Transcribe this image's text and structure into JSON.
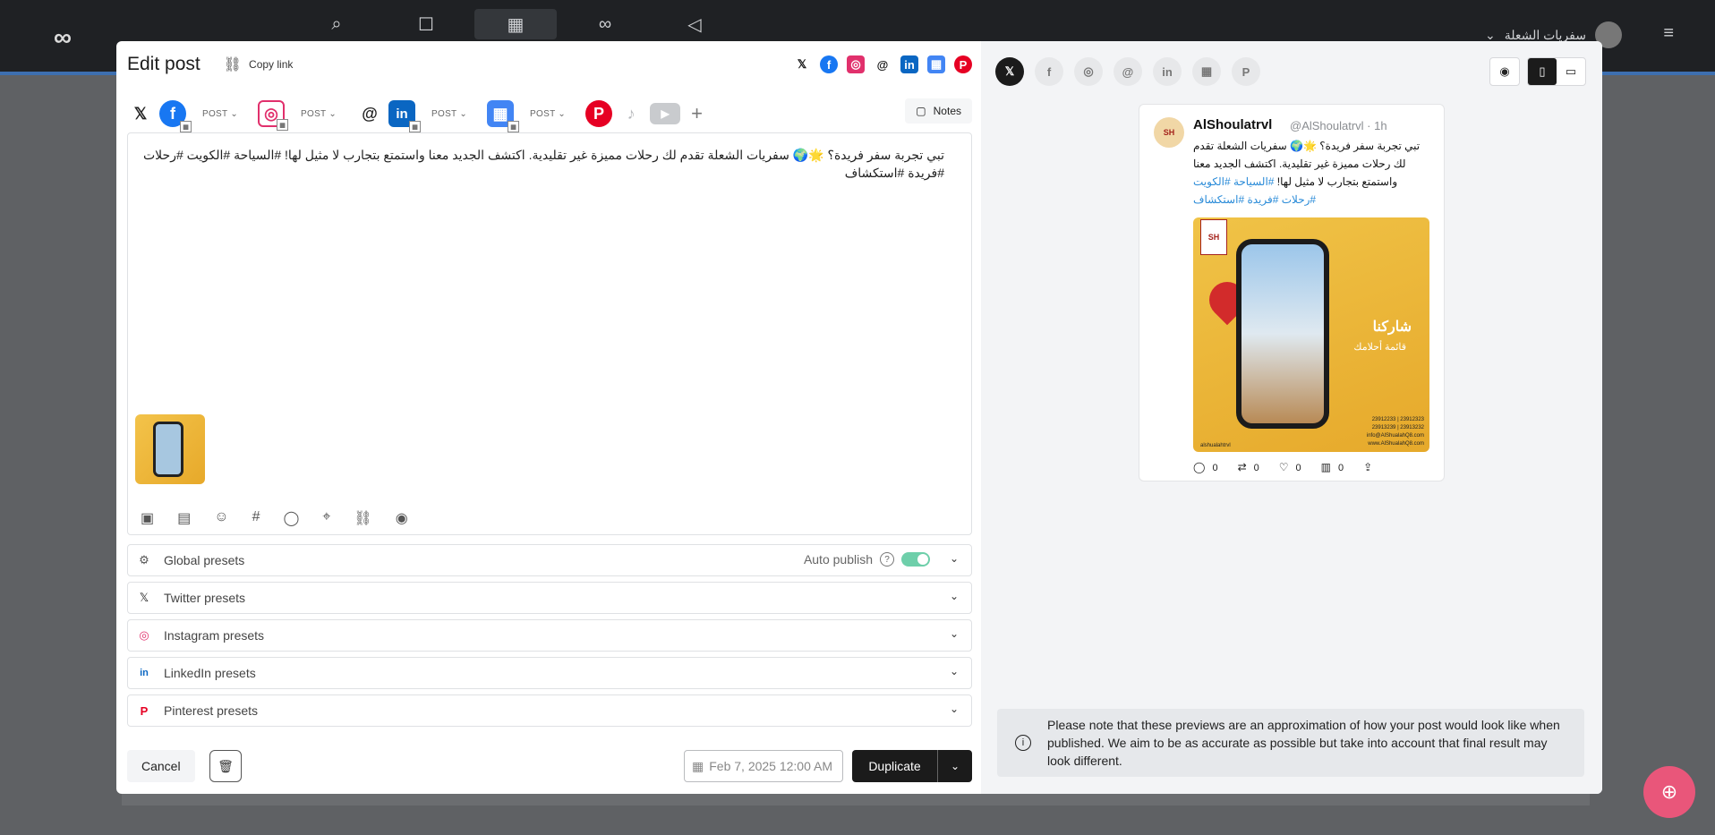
{
  "topbar": {
    "logo": "∞",
    "nav_icons": [
      "analytics-icon",
      "chat-icon",
      "calendar-icon",
      "link-icon",
      "megaphone-icon"
    ],
    "account_name": "سفريات الشعلة",
    "menu_icon": "≡"
  },
  "editor": {
    "title": "Edit post",
    "copy_link": "Copy link",
    "networks": [
      "X",
      "Facebook",
      "Instagram",
      "Threads",
      "LinkedIn",
      "Google Business",
      "Pinterest"
    ],
    "accounts": [
      {
        "network": "X",
        "glyph": "𝕏",
        "color": "#222222"
      },
      {
        "network": "Facebook",
        "glyph": "f",
        "color": "#1877f2",
        "type": "POST"
      },
      {
        "network": "Instagram",
        "glyph": "◎",
        "color": "#e1306c",
        "type": "POST"
      },
      {
        "network": "Threads",
        "glyph": "@",
        "color": "#222222"
      },
      {
        "network": "LinkedIn",
        "glyph": "in",
        "color": "#0a66c2",
        "type": "POST"
      },
      {
        "network": "Google Business",
        "glyph": "▦",
        "color": "#4285f4",
        "type": "POST"
      },
      {
        "network": "Pinterest",
        "glyph": "P",
        "color": "#e60023"
      },
      {
        "network": "TikTok",
        "glyph": "♪",
        "color": "#b7b9bc"
      },
      {
        "network": "YouTube",
        "glyph": "▶",
        "color": "#b7b9bc"
      }
    ],
    "add_label": "+",
    "notes_label": "Notes",
    "post_text": "تبي تجربة سفر فريدة؟ 🌟🌍 سفريات الشعلة تقدم لك رحلات مميزة غير تقليدية. اكتشف الجديد معنا واستمتع بتجارب لا مثيل لها! #السياحة #الكويت #رحلات #فريدة #استكشاف",
    "toolbar_icons": [
      "image-icon",
      "document-icon",
      "emoji-icon",
      "hashtag-icon",
      "comment-icon",
      "location-icon",
      "link-icon",
      "ai-icon"
    ],
    "presets": [
      {
        "label": "Global presets",
        "icon": "⚙",
        "color": "#555555"
      },
      {
        "label": "Twitter presets",
        "icon": "𝕏",
        "color": "#222222"
      },
      {
        "label": "Instagram presets",
        "icon": "◎",
        "color": "#e1306c"
      },
      {
        "label": "LinkedIn presets",
        "icon": "in",
        "color": "#0a66c2"
      },
      {
        "label": "Pinterest presets",
        "icon": "P",
        "color": "#e60023"
      }
    ],
    "auto_publish": "Auto publish",
    "auto_publish_on": true,
    "cancel": "Cancel",
    "date": "Feb 7, 2025 12:00 AM",
    "duplicate": "Duplicate"
  },
  "preview": {
    "tabs": [
      "X",
      "Facebook",
      "Instagram",
      "Threads",
      "LinkedIn",
      "Google Business",
      "Pinterest"
    ],
    "active_tab": "X",
    "tweet": {
      "name": "AlShoulatrvl",
      "handle": "@AlShoulatrvl · 1h",
      "text": "تبي تجربة سفر فريدة؟ 🌟🌍 سفريات الشعلة تقدم لك رحلات مميزة غير تقليدية. اكتشف الجديد معنا واستمتع بتجارب لا مثيل لها!",
      "tags": "#السياحة #الكويت #رحلات #فريدة #استكشاف",
      "image_heading": "شاركنا",
      "image_sub": "قائمة أحلامك",
      "image_contact": "23912233 | 23912323\n23913239 | 23913232\ninfo@AlShualahQ8.com\nwww.AlShualahQ8.com",
      "image_handle": "alshualahtrvl",
      "replies": "0",
      "retweets": "0",
      "likes": "0",
      "views": "0"
    },
    "notice": "Please note that these previews are an approximation of how your post would look like when published. We aim to be as accurate as possible but take into account that final result may look different."
  },
  "colors": {
    "accent_dark": "#1b1b1b",
    "toggle_on": "#6ecfaa",
    "link_blue": "#2a8bd8",
    "fab_pink": "#e9567a"
  }
}
